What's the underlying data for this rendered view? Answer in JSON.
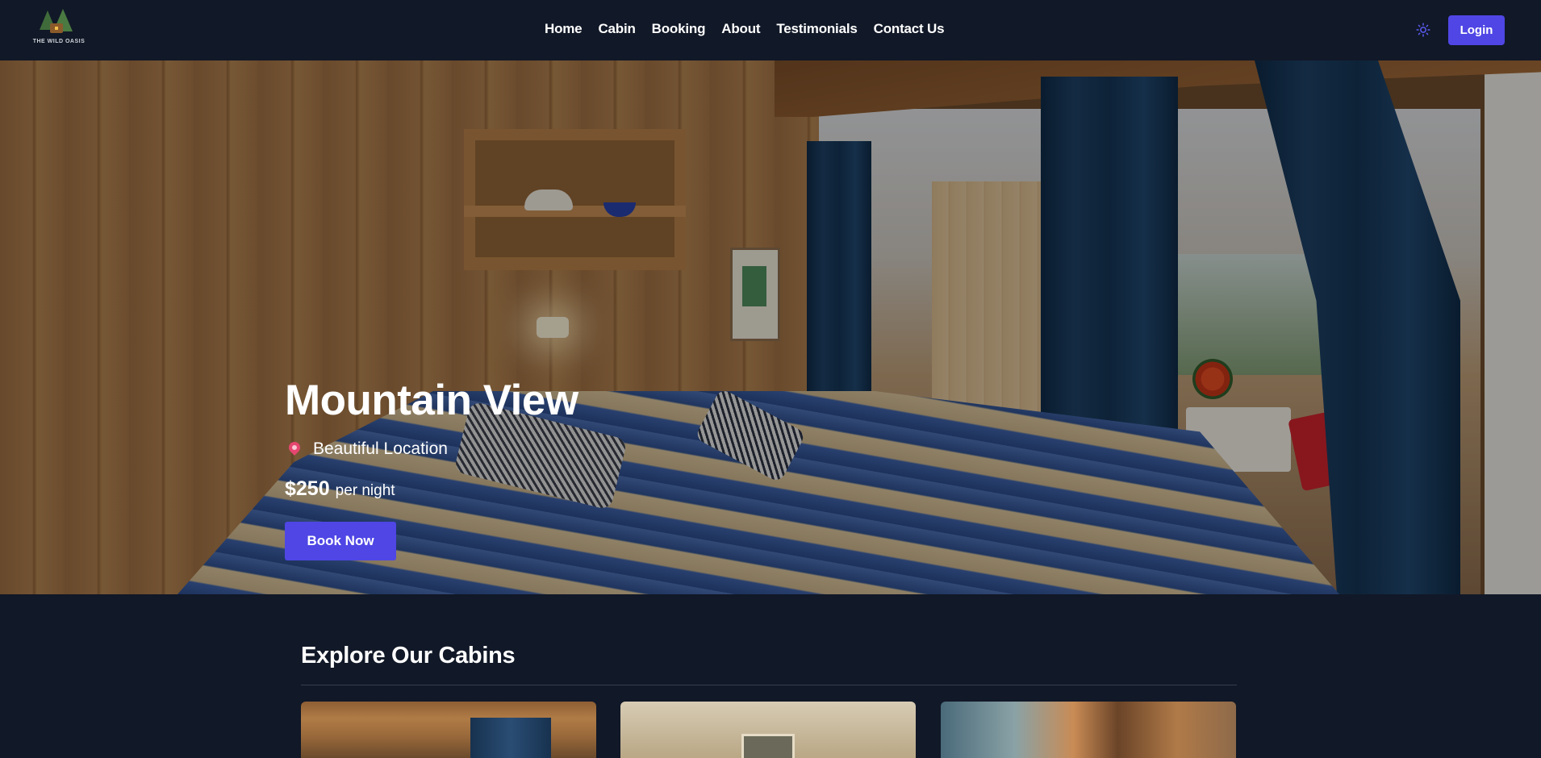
{
  "brand": {
    "name": "THE WILD OASIS"
  },
  "nav": {
    "items": [
      "Home",
      "Cabin",
      "Booking",
      "About",
      "Testimonials",
      "Contact Us"
    ]
  },
  "header": {
    "theme_icon": "sun-icon",
    "login_label": "Login"
  },
  "hero": {
    "title": "Mountain View",
    "location": "Beautiful Location",
    "price": "$250",
    "price_unit": "per night",
    "book_label": "Book Now"
  },
  "explore": {
    "title": "Explore Our Cabins",
    "cards": [
      "cabin-image",
      "cabin-image",
      "cabin-image"
    ]
  },
  "colors": {
    "background": "#111827",
    "accent": "#4f46e5"
  }
}
